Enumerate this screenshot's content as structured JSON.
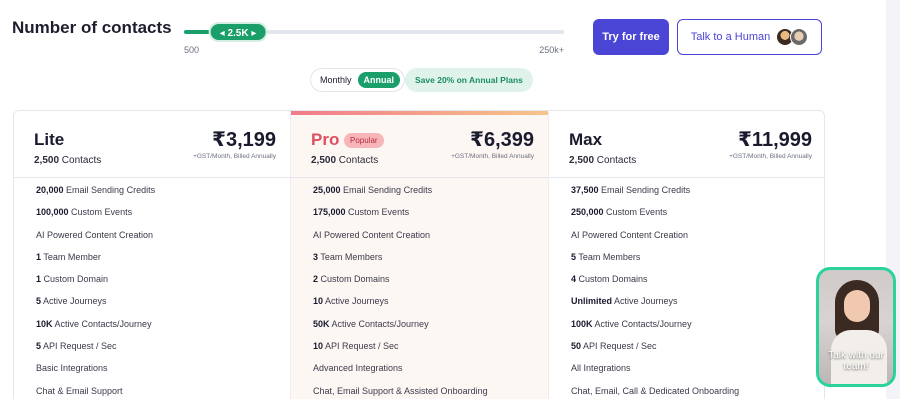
{
  "header": {
    "title": "Number of contacts",
    "slider": {
      "value_label": "◂ 2.5K ▸",
      "min_label": "500",
      "max_label": "250k+",
      "position_fraction": 0.07
    },
    "try_label": "Try for free",
    "human_label": "Talk to a Human"
  },
  "billing": {
    "monthly": "Monthly",
    "annual": "Annual",
    "save": "Save 20% on Annual Plans"
  },
  "colors": {
    "accent": "#4b45d6",
    "green": "#1a9e6a",
    "pro": "#e14f61"
  },
  "plans": [
    {
      "name": "Lite",
      "price": "₹3,199",
      "contacts_bold": "2,500",
      "contacts_text": " Contacts",
      "note": "+GST/Month, Billed Annually",
      "features": [
        {
          "b": "20,000",
          "t": " Email Sending Credits"
        },
        {
          "b": "100,000",
          "t": " Custom Events"
        },
        {
          "b": "",
          "t": "AI Powered Content Creation"
        },
        {
          "b": "1",
          "t": " Team Member"
        },
        {
          "b": "1",
          "t": " Custom Domain"
        },
        {
          "b": "5",
          "t": " Active Journeys"
        },
        {
          "b": "10K",
          "t": " Active Contacts/Journey"
        },
        {
          "b": "5",
          "t": " API Request / Sec"
        },
        {
          "b": "",
          "t": "Basic Integrations"
        },
        {
          "b": "",
          "t": "Chat & Email Support"
        }
      ]
    },
    {
      "name": "Pro",
      "badge": "Popular",
      "price": "₹6,399",
      "contacts_bold": "2,500",
      "contacts_text": " Contacts",
      "note": "+GST/Month, Billed Annually",
      "features": [
        {
          "b": "25,000",
          "t": " Email Sending Credits"
        },
        {
          "b": "175,000",
          "t": " Custom Events"
        },
        {
          "b": "",
          "t": "AI Powered Content Creation"
        },
        {
          "b": "3",
          "t": " Team Members"
        },
        {
          "b": "2",
          "t": " Custom Domains"
        },
        {
          "b": "10",
          "t": " Active Journeys"
        },
        {
          "b": "50K",
          "t": " Active Contacts/Journey"
        },
        {
          "b": "10",
          "t": " API Request / Sec"
        },
        {
          "b": "",
          "t": "Advanced Integrations"
        },
        {
          "b": "",
          "t": "Chat, Email Support & Assisted Onboarding"
        }
      ]
    },
    {
      "name": "Max",
      "price": "₹11,999",
      "contacts_bold": "2,500",
      "contacts_text": " Contacts",
      "note": "+GST/Month, Billed Annually",
      "features": [
        {
          "b": "37,500",
          "t": " Email Sending Credits"
        },
        {
          "b": "250,000",
          "t": " Custom Events"
        },
        {
          "b": "",
          "t": "AI Powered Content Creation"
        },
        {
          "b": "5",
          "t": " Team Members"
        },
        {
          "b": "4",
          "t": " Custom Domains"
        },
        {
          "b": "Unlimited",
          "t": " Active Journeys"
        },
        {
          "b": "100K",
          "t": " Active Contacts/Journey"
        },
        {
          "b": "50",
          "t": " API Request / Sec"
        },
        {
          "b": "",
          "t": "All Integrations"
        },
        {
          "b": "",
          "t": "Chat, Email, Call & Dedicated Onboarding"
        }
      ]
    }
  ],
  "video": {
    "label": "Talk with our team!"
  }
}
